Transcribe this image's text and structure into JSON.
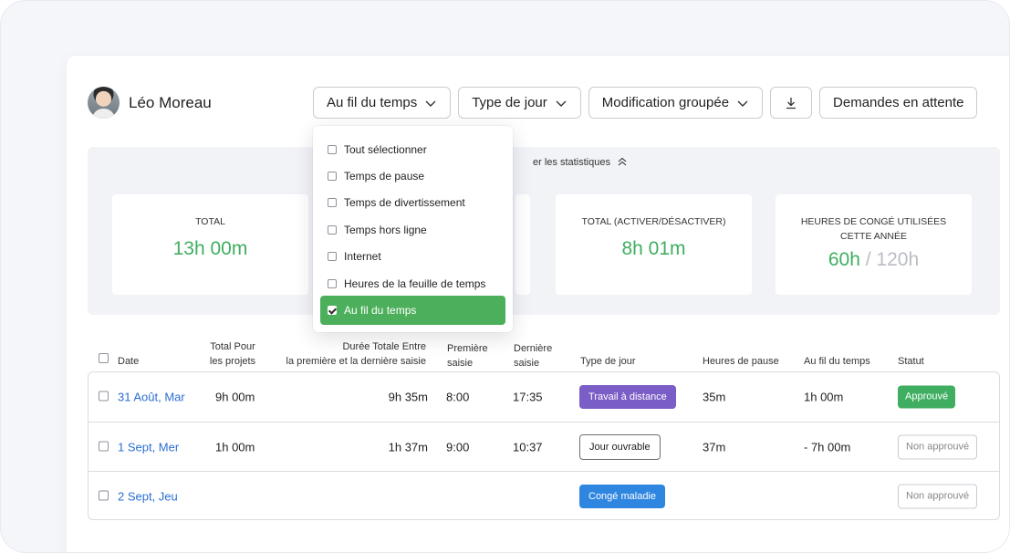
{
  "user": {
    "name": "Léo Moreau"
  },
  "toolbar": {
    "timeline_label": "Au fil du temps",
    "daytype_label": "Type de jour",
    "bulk_edit_label": "Modification groupée",
    "pending_label": "Demandes en attente"
  },
  "stats": {
    "toggle_label": "er les statistiques",
    "total": {
      "label": "TOTAL",
      "value": "13h 00m"
    },
    "toggle_total": {
      "label": "TOTAL (ACTIVER/DÉSACTIVER)",
      "value": "8h 01m"
    },
    "leave": {
      "label": "HEURES DE CONGÉ UTILISÉES CETTE ANNÉE",
      "used": "60h",
      "separator": "/",
      "allowed": "120h"
    }
  },
  "table": {
    "headers": {
      "date": "Date",
      "projects": [
        "Total Pour",
        "les projets"
      ],
      "duration": [
        "Durée Totale Entre",
        "la première et la dernière saisie"
      ],
      "first": [
        "Première",
        "saisie"
      ],
      "last": [
        "Dernière",
        "saisie"
      ],
      "daytype": "Type de jour",
      "pause": "Heures de pause",
      "timeline": "Au fil du temps",
      "status": "Statut"
    },
    "rows": [
      {
        "date": "31 Août, Mar",
        "projects": "9h 00m",
        "duration": "9h 35m",
        "first": "8:00",
        "last": "17:35",
        "daytype": "Travail à distance",
        "pause": "35m",
        "timeline": "1h 00m",
        "status": "Approuvé"
      },
      {
        "date": "1 Sept, Mer",
        "projects": "1h 00m",
        "duration": "1h 37m",
        "first": "9:00",
        "last": "10:37",
        "daytype": "Jour ouvrable",
        "pause": "37m",
        "timeline": "- 7h 00m",
        "status": "Non approuvé"
      },
      {
        "date": "2 Sept, Jeu",
        "projects": "",
        "duration": "",
        "first": "",
        "last": "",
        "daytype": "Congé maladie",
        "pause": "",
        "timeline": "",
        "status": "Non approuvé"
      }
    ]
  },
  "dropdown": {
    "items": [
      {
        "label": "Tout sélectionner",
        "checked": false
      },
      {
        "label": "Temps de pause",
        "checked": false
      },
      {
        "label": "Temps de divertissement",
        "checked": false
      },
      {
        "label": "Temps hors ligne",
        "checked": false
      },
      {
        "label": "Internet",
        "checked": false
      },
      {
        "label": "Heures de la feuille de temps",
        "checked": false
      },
      {
        "label": "Au fil du temps",
        "checked": true
      }
    ]
  },
  "colors": {
    "accent_green": "#3fae61",
    "link_blue": "#2a6fd1",
    "tag_purple": "#7a5dc7",
    "tag_blue": "#2f86e0"
  }
}
